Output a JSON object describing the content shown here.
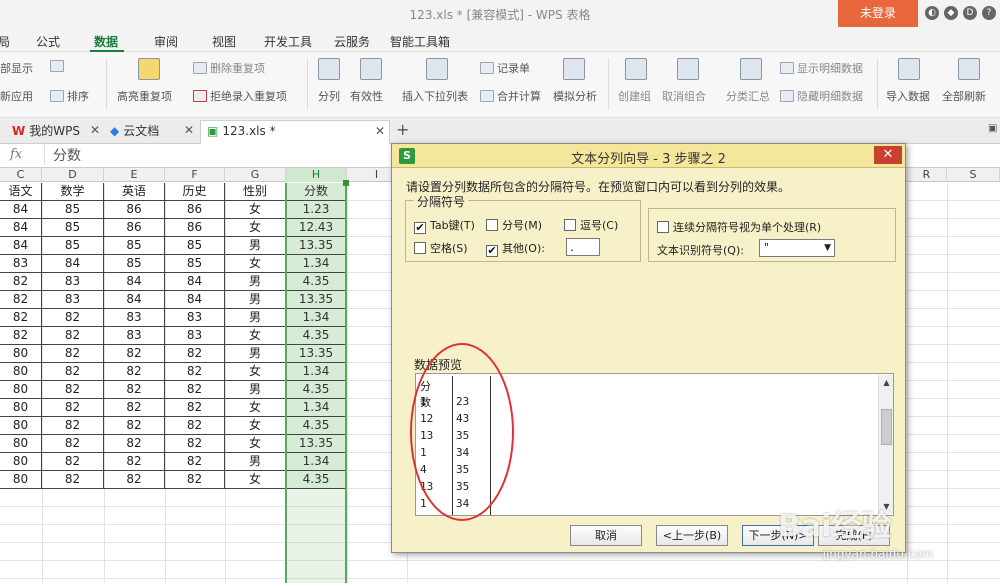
{
  "window": {
    "title": "123.xls * [兼容模式] - WPS 表格",
    "login_button": "未登录"
  },
  "menu": {
    "tabs": [
      "局",
      "公式",
      "数据",
      "审阅",
      "视图",
      "开发工具",
      "云服务",
      "智能工具箱"
    ],
    "active": "数据"
  },
  "ribbon": {
    "show_all": "部显示",
    "reapply": "新应用",
    "sort": "排序",
    "highlight_dup": "高亮重复项",
    "delete_dup": "删除重复项",
    "reject_dup": "拒绝录入重复项",
    "split": "分列",
    "validity": "有效性",
    "insert_dropdown": "插入下拉列表",
    "record": "记录单",
    "merge_calc": "合并计算",
    "simulate": "模拟分析",
    "create_group": "创建组",
    "ungroup": "取消组合",
    "subtotal": "分类汇总",
    "show_detail": "显示明细数据",
    "hide_detail": "隐藏明细数据",
    "import_data": "导入数据",
    "refresh_all": "全部刷新"
  },
  "doc_tabs": [
    {
      "label": "我的WPS"
    },
    {
      "label": "云文档"
    },
    {
      "label": "123.xls *"
    }
  ],
  "formula_bar": {
    "fx": "fx",
    "value": "分数"
  },
  "columns": [
    "C",
    "D",
    "E",
    "F",
    "G",
    "H",
    "I",
    "R",
    "S"
  ],
  "table": {
    "headers": [
      "语文",
      "数学",
      "英语",
      "历史",
      "性别",
      "分数"
    ],
    "rows": [
      [
        "84",
        "85",
        "86",
        "86",
        "女",
        "1.23"
      ],
      [
        "84",
        "85",
        "86",
        "86",
        "女",
        "12.43"
      ],
      [
        "84",
        "85",
        "85",
        "85",
        "男",
        "13.35"
      ],
      [
        "83",
        "84",
        "85",
        "85",
        "女",
        "1.34"
      ],
      [
        "82",
        "83",
        "84",
        "84",
        "男",
        "4.35"
      ],
      [
        "82",
        "83",
        "84",
        "84",
        "男",
        "13.35"
      ],
      [
        "82",
        "82",
        "83",
        "83",
        "男",
        "1.34"
      ],
      [
        "82",
        "82",
        "83",
        "83",
        "女",
        "4.35"
      ],
      [
        "80",
        "82",
        "82",
        "82",
        "男",
        "13.35"
      ],
      [
        "80",
        "82",
        "82",
        "82",
        "女",
        "1.34"
      ],
      [
        "80",
        "82",
        "82",
        "82",
        "男",
        "4.35"
      ],
      [
        "80",
        "82",
        "82",
        "82",
        "女",
        "1.34"
      ],
      [
        "80",
        "82",
        "82",
        "82",
        "女",
        "4.35"
      ],
      [
        "80",
        "82",
        "82",
        "82",
        "女",
        "13.35"
      ],
      [
        "80",
        "82",
        "82",
        "82",
        "男",
        "1.34"
      ],
      [
        "80",
        "82",
        "82",
        "82",
        "女",
        "4.35"
      ]
    ]
  },
  "dialog": {
    "title": "文本分列向导 - 3 步骤之 2",
    "logo": "S",
    "close": "✕",
    "instruction": "请设置分列数据所包含的分隔符号。在预览窗口内可以看到分列的效果。",
    "delimiters_label": "分隔符号",
    "tab": {
      "label": "Tab键(T)",
      "checked": true
    },
    "semicolon": {
      "label": "分号(M)",
      "checked": false
    },
    "comma": {
      "label": "逗号(C)",
      "checked": false
    },
    "space": {
      "label": "空格(S)",
      "checked": false
    },
    "other": {
      "label": "其他(O):",
      "checked": true,
      "value": "."
    },
    "consecutive": {
      "label": "连续分隔符号视为单个处理(R)",
      "checked": false
    },
    "qualifier_label": "文本识别符号(Q):",
    "qualifier_value": "\"",
    "preview_label": "数据预览",
    "preview_rows": [
      [
        "分数",
        ""
      ],
      [
        "1",
        "23"
      ],
      [
        "12",
        "43"
      ],
      [
        "13",
        "35"
      ],
      [
        "1",
        "34"
      ],
      [
        "4",
        "35"
      ],
      [
        "13",
        "35"
      ],
      [
        "1",
        "34"
      ]
    ],
    "buttons": {
      "cancel": "取消",
      "back": "<上一步(B)",
      "next": "下一步(N)>",
      "finish": "完成(F)"
    }
  },
  "watermark": {
    "brand": "Bai经验",
    "url": "jingyan.baidu.com"
  },
  "colors": {
    "accent_green": "#1a7f3c",
    "login_orange": "#e8673c",
    "dialog_bg": "#f6f1c8",
    "annotation_red": "#e03030"
  }
}
